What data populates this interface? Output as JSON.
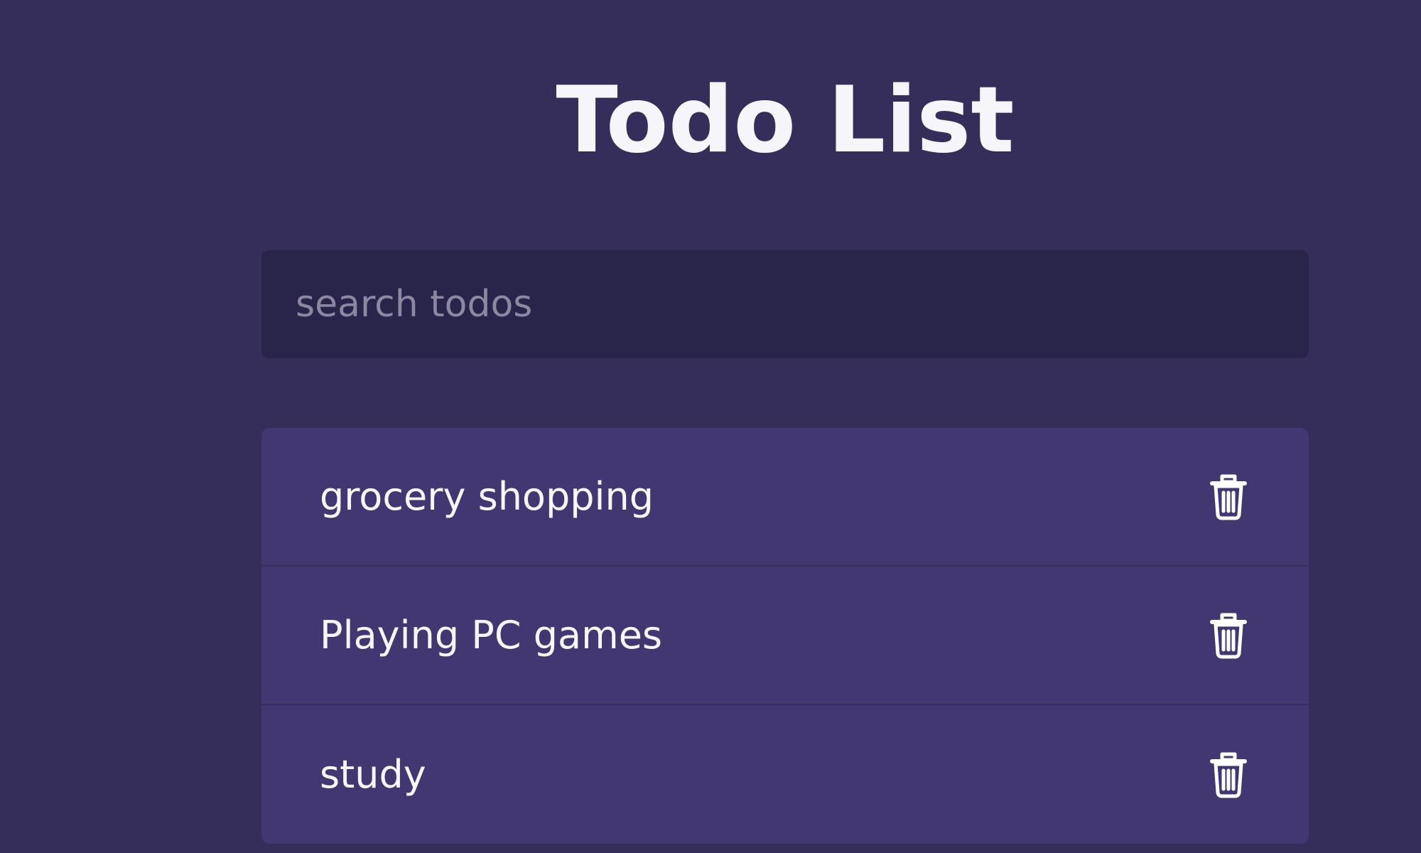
{
  "header": {
    "title": "Todo List"
  },
  "search": {
    "placeholder": "search todos",
    "value": ""
  },
  "todos": [
    {
      "label": "grocery shopping",
      "delete_icon": "trash-icon"
    },
    {
      "label": "Playing PC games",
      "delete_icon": "trash-icon"
    },
    {
      "label": "study",
      "delete_icon": "trash-icon"
    }
  ],
  "colors": {
    "background": "#352e5a",
    "search_background": "#29244a",
    "list_background": "#423770",
    "text": "#f4f3f8",
    "placeholder": "#8c889f"
  }
}
